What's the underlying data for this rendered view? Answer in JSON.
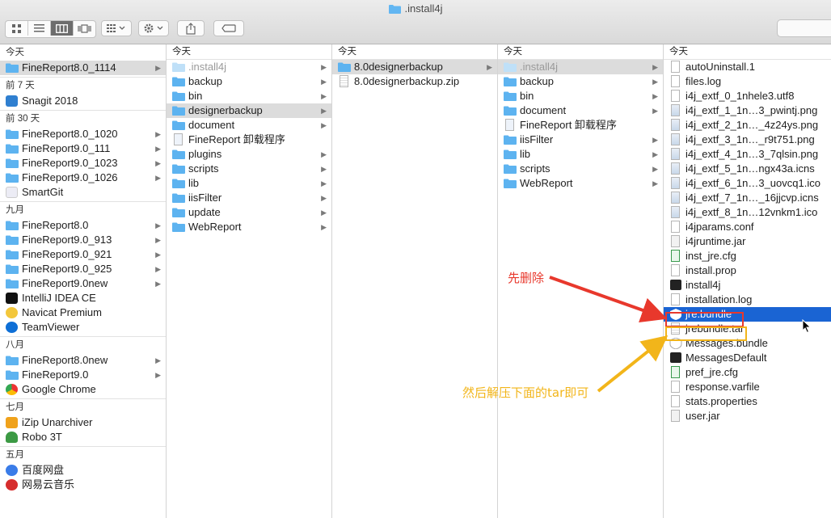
{
  "window": {
    "title": ".install4j"
  },
  "toolbar": {
    "view_modes": [
      "icon-view",
      "list-view",
      "column-view",
      "gallery-view"
    ],
    "active_view": 2,
    "group_menu": "group-by-icon",
    "action_menu": "gear-icon",
    "share": "share-icon",
    "tag": "tag-icon"
  },
  "sidebar": {
    "groups": [
      {
        "label": "今天",
        "items": [
          {
            "label": "FineReport8.0_1114",
            "icon": "folder",
            "arrow": true,
            "selected": "gray"
          }
        ]
      },
      {
        "label": "前 7 天",
        "items": [
          {
            "label": "Snagit 2018",
            "icon": "snagit"
          }
        ]
      },
      {
        "label": "前 30 天",
        "items": [
          {
            "label": "FineReport8.0_1020",
            "icon": "folder",
            "arrow": true
          },
          {
            "label": "FineReport9.0_111",
            "icon": "folder",
            "arrow": true
          },
          {
            "label": "FineReport9.0_1023",
            "icon": "folder",
            "arrow": true
          },
          {
            "label": "FineReport9.0_1026",
            "icon": "folder",
            "arrow": true
          },
          {
            "label": "SmartGit",
            "icon": "smartgit"
          }
        ]
      },
      {
        "label": "九月",
        "items": [
          {
            "label": "FineReport8.0",
            "icon": "folder",
            "arrow": true
          },
          {
            "label": "FineReport9.0_913",
            "icon": "folder",
            "arrow": true
          },
          {
            "label": "FineReport9.0_921",
            "icon": "folder",
            "arrow": true
          },
          {
            "label": "FineReport9.0_925",
            "icon": "folder",
            "arrow": true
          },
          {
            "label": "FineReport9.0new",
            "icon": "folder",
            "arrow": true
          },
          {
            "label": "IntelliJ IDEA CE",
            "icon": "intellij"
          },
          {
            "label": "Navicat Premium",
            "icon": "navicat"
          },
          {
            "label": "TeamViewer",
            "icon": "teamviewer"
          }
        ]
      },
      {
        "label": "八月",
        "items": [
          {
            "label": "FineReport8.0new",
            "icon": "folder",
            "arrow": true
          },
          {
            "label": "FineReport9.0",
            "icon": "folder",
            "arrow": true
          },
          {
            "label": "Google Chrome",
            "icon": "chrome"
          }
        ]
      },
      {
        "label": "七月",
        "items": [
          {
            "label": "iZip Unarchiver",
            "icon": "izip"
          },
          {
            "label": "Robo 3T",
            "icon": "robo"
          }
        ]
      },
      {
        "label": "五月",
        "items": [
          {
            "label": "百度网盘",
            "icon": "baidu"
          },
          {
            "label": "网易云音乐",
            "icon": "netease"
          }
        ]
      }
    ]
  },
  "columns": [
    {
      "header": "今天",
      "items": [
        {
          "label": ".install4j",
          "icon": "folder-light",
          "arrow": true,
          "dim": true
        },
        {
          "label": "backup",
          "icon": "folder",
          "arrow": true
        },
        {
          "label": "bin",
          "icon": "folder",
          "arrow": true
        },
        {
          "label": "designerbackup",
          "icon": "folder",
          "arrow": true,
          "selected": "gray"
        },
        {
          "label": "document",
          "icon": "folder",
          "arrow": true
        },
        {
          "label": "FineReport 卸载程序",
          "icon": "uninstaller"
        },
        {
          "label": "plugins",
          "icon": "folder",
          "arrow": true
        },
        {
          "label": "scripts",
          "icon": "folder",
          "arrow": true
        },
        {
          "label": "lib",
          "icon": "folder",
          "arrow": true
        },
        {
          "label": "iisFilter",
          "icon": "folder",
          "arrow": true
        },
        {
          "label": "update",
          "icon": "folder",
          "arrow": true
        },
        {
          "label": "WebReport",
          "icon": "folder",
          "arrow": true
        }
      ]
    },
    {
      "header": "今天",
      "items": [
        {
          "label": "8.0designerbackup",
          "icon": "folder",
          "arrow": true,
          "selected": "gray"
        },
        {
          "label": "8.0designerbackup.zip",
          "icon": "zip"
        }
      ]
    },
    {
      "header": "今天",
      "items": [
        {
          "label": ".install4j",
          "icon": "folder-light",
          "arrow": true,
          "dim": true,
          "selected": "gray"
        },
        {
          "label": "backup",
          "icon": "folder",
          "arrow": true
        },
        {
          "label": "bin",
          "icon": "folder",
          "arrow": true
        },
        {
          "label": "document",
          "icon": "folder",
          "arrow": true
        },
        {
          "label": "FineReport 卸载程序",
          "icon": "uninstaller"
        },
        {
          "label": "iisFilter",
          "icon": "folder",
          "arrow": true
        },
        {
          "label": "lib",
          "icon": "folder",
          "arrow": true
        },
        {
          "label": "scripts",
          "icon": "folder",
          "arrow": true
        },
        {
          "label": "WebReport",
          "icon": "folder",
          "arrow": true
        }
      ]
    },
    {
      "header": "今天",
      "items": [
        {
          "label": "autoUninstall.1",
          "icon": "doc"
        },
        {
          "label": "files.log",
          "icon": "doc"
        },
        {
          "label": "i4j_extf_0_1nhele3.utf8",
          "icon": "doc"
        },
        {
          "label": "i4j_extf_1_1n…3_pwintj.png",
          "icon": "img"
        },
        {
          "label": "i4j_extf_2_1n…_4z24ys.png",
          "icon": "img"
        },
        {
          "label": "i4j_extf_3_1n…_r9t751.png",
          "icon": "img"
        },
        {
          "label": "i4j_extf_4_1n…3_7qlsin.png",
          "icon": "img"
        },
        {
          "label": "i4j_extf_5_1n…ngx43a.icns",
          "icon": "img"
        },
        {
          "label": "i4j_extf_6_1n…3_uovcq1.ico",
          "icon": "img"
        },
        {
          "label": "i4j_extf_7_1n…_16jjcvp.icns",
          "icon": "img"
        },
        {
          "label": "i4j_extf_8_1n…12vnkm1.ico",
          "icon": "img"
        },
        {
          "label": "i4jparams.conf",
          "icon": "doc"
        },
        {
          "label": "i4jruntime.jar",
          "icon": "jar"
        },
        {
          "label": "inst_jre.cfg",
          "icon": "cfg"
        },
        {
          "label": "install.prop",
          "icon": "doc"
        },
        {
          "label": "install4j",
          "icon": "terminal"
        },
        {
          "label": "installation.log",
          "icon": "doc"
        },
        {
          "label": "jre.bundle",
          "icon": "bundle",
          "selected": "blue"
        },
        {
          "label": "jrebundle.tar",
          "icon": "tar"
        },
        {
          "label": "Messages.bundle",
          "icon": "bundle-light"
        },
        {
          "label": "MessagesDefault",
          "icon": "terminal"
        },
        {
          "label": "pref_jre.cfg",
          "icon": "cfg"
        },
        {
          "label": "response.varfile",
          "icon": "doc"
        },
        {
          "label": "stats.properties",
          "icon": "doc"
        },
        {
          "label": "user.jar",
          "icon": "jar"
        }
      ]
    }
  ],
  "annotations": {
    "delete_first": "先删除",
    "then_extract": "然后解压下面的tar即可",
    "red": "#e8382c",
    "yellow": "#f2b51a"
  },
  "colors": {
    "folder": "#5db3f0",
    "selection_blue": "#1a64d3",
    "selection_gray": "#dcdcdc"
  }
}
